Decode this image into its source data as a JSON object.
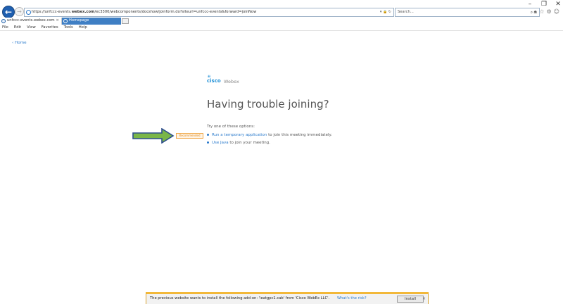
{
  "window": {
    "minimize": "–",
    "restore": "❐",
    "close": "✕"
  },
  "address_bar": {
    "url_prefix": "https://unfccc-events.",
    "url_domain": "webex.com",
    "url_rest": "/ec3300/webcomponents/docshow/joinform.do?siteurl=unfccc-events&forward=joinNow",
    "url_icons": "▾ 🔒 ↻",
    "search_placeholder": "Search...",
    "search_icon": "⌕ ▾"
  },
  "toolbar_icons": [
    "⌂",
    "☆",
    "⚙",
    "☺"
  ],
  "tabs": [
    {
      "label": "unfccc-events.webex.com",
      "active": false,
      "close": "×"
    },
    {
      "label": "Homepage",
      "active": true
    }
  ],
  "menu": [
    "File",
    "Edit",
    "View",
    "Favorites",
    "Tools",
    "Help"
  ],
  "page": {
    "home_link": "‹ Home",
    "logo_dots": "ılıılı",
    "logo_word": "cisco",
    "logo_product": "Webex",
    "headline": "Having trouble joining?",
    "try_text": "Try one of these options:",
    "recommended_badge": "Recommended",
    "option1_link": "Run a temporary application",
    "option1_rest": " to join this meeting immediately.",
    "option2_link": "Use Java",
    "option2_rest": " to join your meeting."
  },
  "colors": {
    "link": "#2b7bcc",
    "arrow_fill": "#7ab648",
    "arrow_border": "#2d4e8c",
    "notification_bar": "#f2b83a"
  },
  "notification": {
    "message": "The previous website wants to install the following add-on: 'ieatgpc1.cab' from 'Cisco WebEx LLC'.",
    "risk_link": "What's the risk?",
    "install_button": "Install",
    "close": "×"
  }
}
